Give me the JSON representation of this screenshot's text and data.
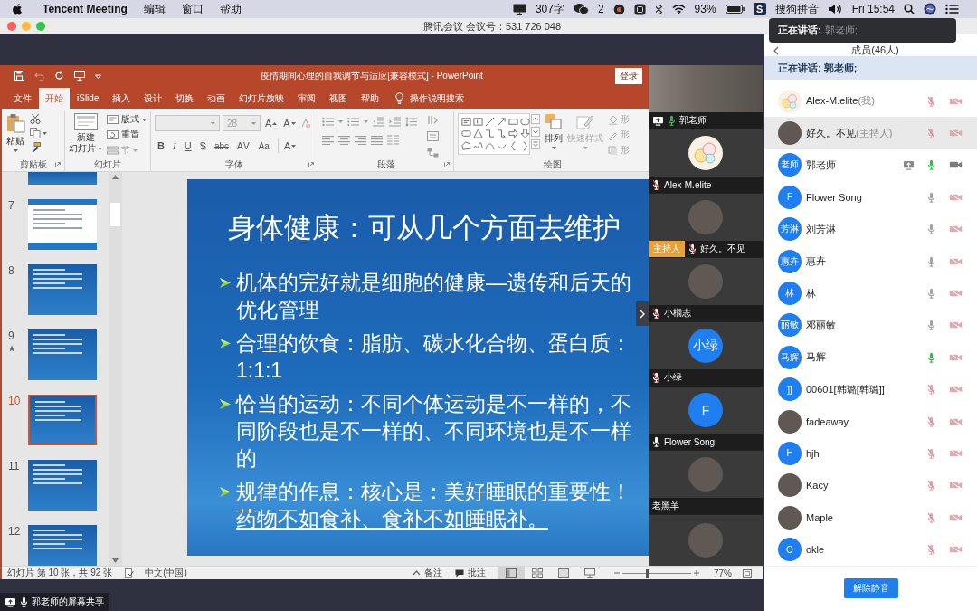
{
  "menu_bar": {
    "app_name": "Tencent Meeting",
    "menus": [
      "编辑",
      "窗口",
      "帮助"
    ],
    "word_count": "307字",
    "wechat_unread": "2",
    "battery": "93%",
    "ime_logo": "S",
    "input_method": "搜狗拼音",
    "clock": "Fri 15:54"
  },
  "window": {
    "title": "腾讯会议 会议号：531 726 048"
  },
  "speaking_toast": {
    "label": "正在讲话:",
    "speaker": "郭老师;"
  },
  "powerpoint": {
    "title": "疫情期间心理的自我调节与适应[兼容模式] - PowerPoint",
    "sign_in": "登录",
    "tabs": [
      {
        "label": "文件",
        "selected": false
      },
      {
        "label": "开始",
        "selected": true
      },
      {
        "label": "iSlide",
        "selected": false
      },
      {
        "label": "插入",
        "selected": false
      },
      {
        "label": "设计",
        "selected": false
      },
      {
        "label": "切换",
        "selected": false
      },
      {
        "label": "动画",
        "selected": false
      },
      {
        "label": "幻灯片放映",
        "selected": false
      },
      {
        "label": "审阅",
        "selected": false
      },
      {
        "label": "视图",
        "selected": false
      },
      {
        "label": "帮助",
        "selected": false
      }
    ],
    "tell_me": "操作说明搜索",
    "ribbon": {
      "groups": [
        {
          "kind": "clipboard",
          "label": "剪贴板",
          "buttons": [
            {
              "label": "粘贴",
              "disabled": false
            }
          ]
        },
        {
          "kind": "slides",
          "label": "幻灯片",
          "buttons": [
            {
              "lines": [
                "新建",
                "幻灯片"
              ],
              "disabled": false
            },
            {
              "label": "版式",
              "disabled": false
            },
            {
              "label": "重置",
              "disabled": false
            },
            {
              "label": "节",
              "disabled": true
            }
          ]
        },
        {
          "kind": "font",
          "label": "字体",
          "size": {
            "value": "28",
            "disabled": true
          },
          "buttons": [
            {
              "label": "A",
              "kind": "grow"
            },
            {
              "label": "A",
              "kind": "shrink"
            },
            {
              "label": "B",
              "kind": "bold"
            },
            {
              "label": "I",
              "kind": "italic"
            },
            {
              "label": "U",
              "kind": "underline"
            },
            {
              "label": "S",
              "kind": "shadow"
            },
            {
              "label": "abc",
              "kind": "strike"
            },
            {
              "label": "AV",
              "kind": "spacing"
            },
            {
              "label": "Aa",
              "kind": "case"
            },
            {
              "label": "A",
              "kind": "color"
            }
          ]
        },
        {
          "kind": "paragraph",
          "label": "段落"
        },
        {
          "kind": "drawing",
          "label": "绘图",
          "buttons": [
            {
              "label": "排列",
              "disabled": false
            },
            {
              "label": "快速样式",
              "disabled": true
            },
            {
              "label": "形",
              "disabled": true
            },
            {
              "label": "形",
              "disabled": true
            },
            {
              "label": "形",
              "disabled": true
            }
          ]
        }
      ]
    },
    "thumbnails": [
      {
        "kind": "title",
        "partial": true,
        "selected": false,
        "starred": false
      },
      {
        "number": "7",
        "kind": "document",
        "partial": false,
        "selected": false,
        "starred": false
      },
      {
        "number": "8",
        "kind": "title",
        "partial": false,
        "selected": false,
        "starred": false
      },
      {
        "number": "9",
        "kind": "title",
        "partial": false,
        "selected": false,
        "starred": true
      },
      {
        "number": "10",
        "kind": "title",
        "partial": false,
        "selected": true,
        "starred": false
      },
      {
        "number": "11",
        "kind": "title",
        "partial": false,
        "selected": false,
        "starred": false
      },
      {
        "number": "12",
        "kind": "title",
        "partial": true,
        "selected": false,
        "starred": false
      }
    ],
    "slide": {
      "title": "身体健康：可从几个方面去维护",
      "bullets": [
        {
          "lines": [
            {
              "text": "机体的完好就是细胞的健康—遗传和后天的",
              "underlined": false
            },
            {
              "text": "优化管理",
              "underlined": false
            }
          ]
        },
        {
          "lines": [
            {
              "text": "合理的饮食：脂肪、碳水化合物、蛋白质：",
              "underlined": false
            },
            {
              "text": "1:1:1",
              "underlined": false
            }
          ]
        },
        {
          "lines": [
            {
              "text": "恰当的运动：不同个体运动是不一样的，不",
              "underlined": false
            },
            {
              "text": "同阶段也是不一样的、不同环境也是不一样",
              "underlined": false
            },
            {
              "text": "的",
              "underlined": false
            }
          ]
        },
        {
          "lines": [
            {
              "text": "规律的作息：核心是：美好睡眠的重要性！",
              "underlined": false
            },
            {
              "text": "药物不如食补、食补不如睡眠补。",
              "underlined": true
            }
          ]
        }
      ]
    },
    "status_bar": {
      "slide_info": "幻灯片 第 10 张，共 92 张",
      "language": "中文(中国)",
      "notes": "备注",
      "comments": "批注",
      "views": [
        {
          "kind": "normal",
          "selected": true
        },
        {
          "kind": "sorter",
          "selected": false
        },
        {
          "kind": "reading",
          "selected": false
        },
        {
          "kind": "slideshow",
          "selected": false
        }
      ],
      "zoom": {
        "level": 0.36,
        "label": "77%"
      }
    }
  },
  "video_strip": {
    "tiles": [
      {
        "kind": "video",
        "name": "郭老师",
        "audio": true,
        "muted": false,
        "speaking": true,
        "sharing": true
      },
      {
        "kind": "avatar",
        "avatar": {
          "kind": "cartoon"
        },
        "name": "Alex-M.elite",
        "audio": true,
        "muted": true,
        "speaking": false,
        "sharing": false
      },
      {
        "kind": "avatar",
        "avatar": {
          "kind": "photo"
        },
        "badge": "主持人",
        "name": "好久。不见",
        "audio": true,
        "muted": true,
        "speaking": false,
        "sharing": false
      },
      {
        "kind": "avatar",
        "avatar": {
          "kind": "photo"
        },
        "name": "小榈志",
        "audio": true,
        "muted": true,
        "speaking": false,
        "sharing": false
      },
      {
        "kind": "avatar",
        "avatar": {
          "kind": "initials",
          "text": "小绿"
        },
        "name": "小绿",
        "audio": true,
        "muted": true,
        "speaking": false,
        "sharing": false
      },
      {
        "kind": "avatar",
        "avatar": {
          "kind": "initials",
          "text": "F"
        },
        "name": "Flower Song",
        "audio": true,
        "muted": false,
        "speaking": false,
        "sharing": false
      },
      {
        "kind": "avatar",
        "avatar": {
          "kind": "photo"
        },
        "name": "老黑羊",
        "audio": false,
        "muted": false,
        "speaking": false,
        "sharing": false
      },
      {
        "kind": "avatar",
        "avatar": {
          "kind": "photo"
        },
        "audio": false,
        "muted": false,
        "speaking": false,
        "sharing": false
      }
    ]
  },
  "screen_share_label": "郭老师的屏幕共享",
  "participants": {
    "header": "成员(46人)",
    "speaking_bar": "正在讲话: 郭老师;",
    "rows": [
      {
        "name": "Alex-M.elite",
        "note": "(我)",
        "avatar": {
          "kind": "cartoon"
        },
        "selected": false,
        "sharing": false,
        "muted": true,
        "speaking": false,
        "camera_on": false
      },
      {
        "name": "好久。不见",
        "note": "(主持人)",
        "avatar": {
          "kind": "photo"
        },
        "selected": true,
        "sharing": false,
        "muted": true,
        "speaking": false,
        "camera_on": false
      },
      {
        "name": "郭老师",
        "avatar": {
          "kind": "initials",
          "text": "老师"
        },
        "selected": false,
        "sharing": true,
        "muted": false,
        "speaking": true,
        "camera_on": true
      },
      {
        "name": "Flower Song",
        "avatar": {
          "kind": "initials",
          "text": "F"
        },
        "selected": false,
        "sharing": false,
        "muted": false,
        "speaking": false,
        "camera_on": false
      },
      {
        "name": "刘芳淋",
        "avatar": {
          "kind": "initials",
          "text": "芳淋"
        },
        "selected": false,
        "sharing": false,
        "muted": false,
        "speaking": false,
        "camera_on": false
      },
      {
        "name": "惠卉",
        "avatar": {
          "kind": "initials",
          "text": "惠卉"
        },
        "selected": false,
        "sharing": false,
        "muted": false,
        "speaking": false,
        "camera_on": false
      },
      {
        "name": "林",
        "avatar": {
          "kind": "initials",
          "text": "林"
        },
        "selected": false,
        "sharing": false,
        "muted": false,
        "speaking": false,
        "camera_on": false
      },
      {
        "name": "邓丽敏",
        "avatar": {
          "kind": "initials",
          "text": "丽敏"
        },
        "selected": false,
        "sharing": false,
        "muted": false,
        "speaking": false,
        "camera_on": false
      },
      {
        "name": "马辉",
        "avatar": {
          "kind": "initials",
          "text": "马辉"
        },
        "selected": false,
        "sharing": false,
        "muted": false,
        "speaking": true,
        "camera_on": false
      },
      {
        "name": "00601[韩璐[韩璐]]",
        "avatar": {
          "kind": "initials",
          "text": "]]"
        },
        "selected": false,
        "sharing": false,
        "muted": true,
        "speaking": false,
        "camera_on": false
      },
      {
        "name": "fadeaway",
        "avatar": {
          "kind": "photo"
        },
        "selected": false,
        "sharing": false,
        "muted": true,
        "speaking": false,
        "camera_on": false
      },
      {
        "name": "hjh",
        "avatar": {
          "kind": "initials",
          "text": "H"
        },
        "selected": false,
        "sharing": false,
        "muted": true,
        "speaking": false,
        "camera_on": false
      },
      {
        "name": "Kacy",
        "avatar": {
          "kind": "photo"
        },
        "selected": false,
        "sharing": false,
        "muted": true,
        "speaking": false,
        "camera_on": false
      },
      {
        "name": "Maple",
        "avatar": {
          "kind": "photo"
        },
        "selected": false,
        "sharing": false,
        "muted": true,
        "speaking": false,
        "camera_on": false
      },
      {
        "name": "okle",
        "avatar": {
          "kind": "initials",
          "text": "O"
        },
        "selected": false,
        "sharing": false,
        "muted": true,
        "speaking": false,
        "camera_on": false
      }
    ],
    "unmute_all": "解除静音"
  }
}
